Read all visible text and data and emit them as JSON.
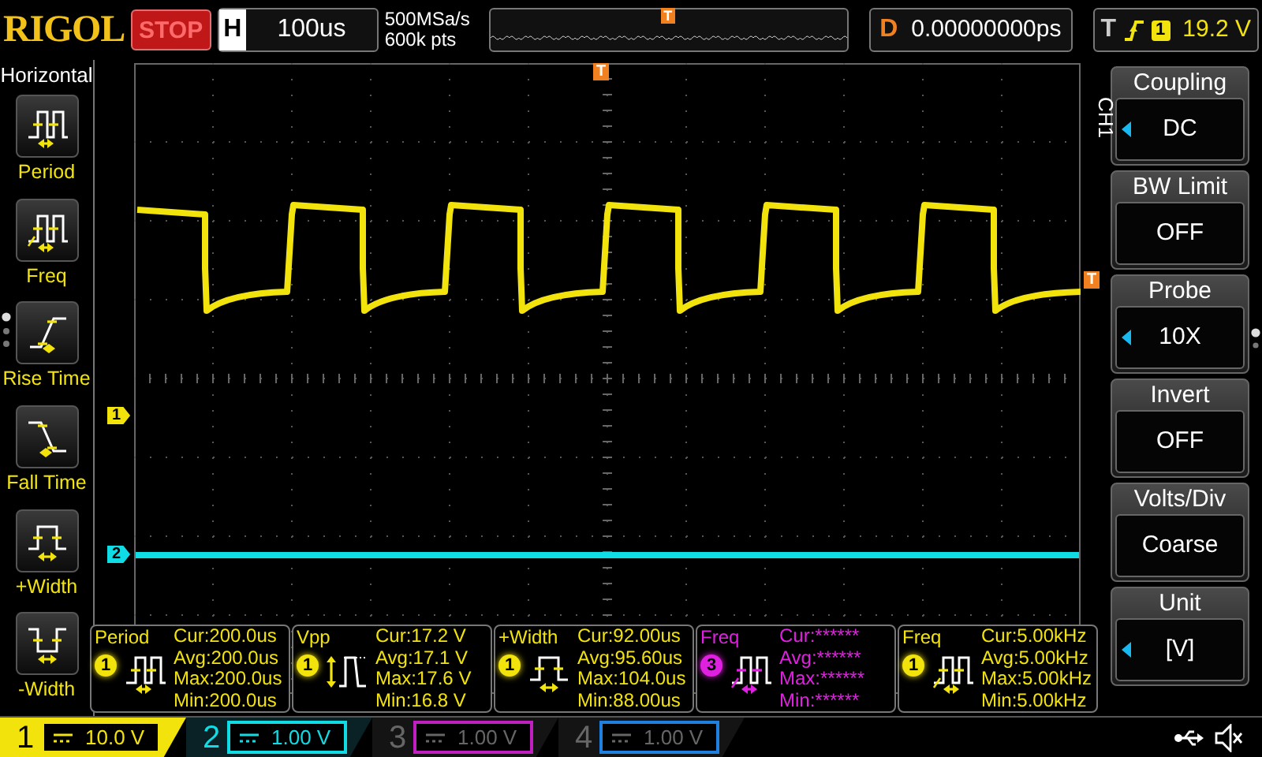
{
  "top_bar": {
    "brand": "RIGOL",
    "run_state": "STOP",
    "horizontal": {
      "label": "H",
      "timebase": "100us"
    },
    "sample_rate": "500MSa/s",
    "memory_depth": "600k pts",
    "overview_trigger": "T",
    "delay": {
      "label": "D",
      "value": "0.00000000ps"
    },
    "trigger": {
      "label": "T",
      "source": "1",
      "level": "19.2 V"
    }
  },
  "left_menu": {
    "title": "Horizontal",
    "items": [
      {
        "label": "Period",
        "kind": "period"
      },
      {
        "label": "Freq",
        "kind": "freq"
      },
      {
        "label": "Rise Time",
        "kind": "rise"
      },
      {
        "label": "Fall Time",
        "kind": "fall"
      },
      {
        "label": "+Width",
        "kind": "pos_width"
      },
      {
        "label": "-Width",
        "kind": "neg_width"
      }
    ]
  },
  "display": {
    "trigger_marker": "T",
    "trigger_level_marker": "T",
    "channel_markers": [
      {
        "label": "1",
        "color": "#f2e30c"
      },
      {
        "label": "2",
        "color": "#10dce6"
      }
    ]
  },
  "right_menu": {
    "channel": "CH1",
    "items": [
      {
        "title": "Coupling",
        "value": "DC",
        "adjustable": true
      },
      {
        "title": "BW Limit",
        "value": "OFF",
        "adjustable": false
      },
      {
        "title": "Probe",
        "value": "10X",
        "adjustable": true
      },
      {
        "title": "Invert",
        "value": "OFF",
        "adjustable": false
      },
      {
        "title": "Volts/Div",
        "value": "Coarse",
        "adjustable": false
      },
      {
        "title": "Unit",
        "value": "[V]",
        "adjustable": true
      }
    ]
  },
  "measurements": [
    {
      "title": "Period",
      "source": "1",
      "kind": "period",
      "color": "#f2e30c",
      "readings": [
        "Cur:200.0us",
        "Avg:200.0us",
        "Max:200.0us",
        "Min:200.0us"
      ]
    },
    {
      "title": "Vpp",
      "source": "1",
      "kind": "vpp",
      "color": "#f2e30c",
      "readings": [
        "Cur:17.2 V",
        "Avg:17.1 V",
        "Max:17.6 V",
        "Min:16.8 V"
      ]
    },
    {
      "title": "+Width",
      "source": "1",
      "kind": "pos_width",
      "color": "#f2e30c",
      "readings": [
        "Cur:92.00us",
        "Avg:95.60us",
        "Max:104.0us",
        "Min:88.00us"
      ]
    },
    {
      "title": "Freq",
      "source": "3",
      "kind": "freq",
      "color": "#e020e0",
      "readings": [
        "Cur:******",
        "Avg:******",
        "Max:******",
        "Min:******"
      ]
    },
    {
      "title": "Freq",
      "source": "1",
      "kind": "freq",
      "color": "#f2e30c",
      "readings": [
        "Cur:5.00kHz",
        "Avg:5.00kHz",
        "Max:5.00kHz",
        "Min:5.00kHz"
      ]
    }
  ],
  "channels": [
    {
      "number": "1",
      "scale": "10.0 V",
      "selected": true,
      "on": true,
      "color": "#f2e30c"
    },
    {
      "number": "2",
      "scale": "1.00 V",
      "selected": false,
      "on": true,
      "color": "#10dce6"
    },
    {
      "number": "3",
      "scale": "1.00 V",
      "selected": false,
      "on": false,
      "color": "#c020c0"
    },
    {
      "number": "4",
      "scale": "1.00 V",
      "selected": false,
      "on": false,
      "color": "#2080e0"
    }
  ]
}
